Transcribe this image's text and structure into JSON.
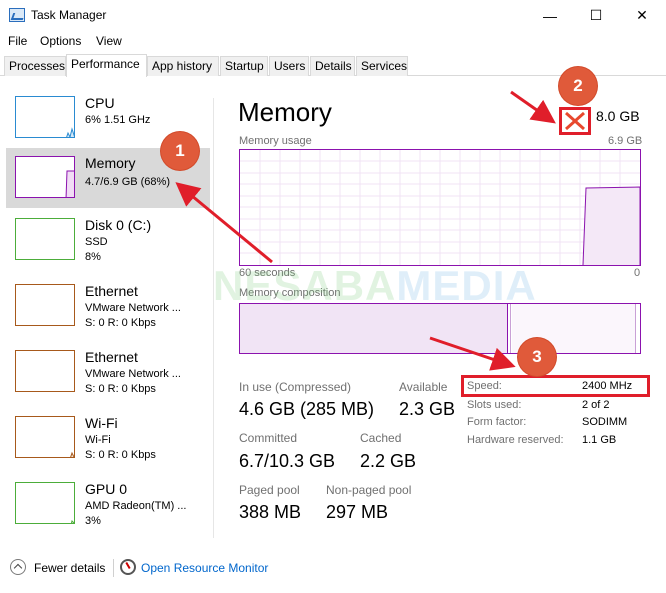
{
  "window": {
    "title": "Task Manager",
    "minimize_glyph": "—",
    "maximize_glyph": "☐",
    "close_glyph": "✕"
  },
  "menu": [
    "File",
    "Options",
    "View"
  ],
  "tabs": [
    "Processes",
    "Performance",
    "App history",
    "Startup",
    "Users",
    "Details",
    "Services"
  ],
  "active_tab": "Performance",
  "sidebar": [
    {
      "name": "CPU",
      "lines": [
        "6% 1.51 GHz"
      ],
      "color": "#2a8bd1",
      "icon": "cpu-graph"
    },
    {
      "name": "Memory",
      "lines": [
        "4.7/6.9 GB (68%)"
      ],
      "color": "#8b12ae",
      "icon": "memory-graph",
      "selected": true
    },
    {
      "name": "Disk 0 (C:)",
      "lines": [
        "SSD",
        "8%"
      ],
      "color": "#4cad3a",
      "icon": "disk-graph"
    },
    {
      "name": "Ethernet",
      "lines": [
        "VMware Network ...",
        "S: 0 R: 0 Kbps"
      ],
      "color": "#a7591b",
      "icon": "ethernet-graph"
    },
    {
      "name": "Ethernet",
      "lines": [
        "VMware Network ...",
        "S: 0 R: 0 Kbps"
      ],
      "color": "#a7591b",
      "icon": "ethernet-graph"
    },
    {
      "name": "Wi-Fi",
      "lines": [
        "Wi-Fi",
        "S: 0 R: 0 Kbps"
      ],
      "color": "#a7591b",
      "icon": "wifi-graph"
    },
    {
      "name": "GPU 0",
      "lines": [
        "AMD Radeon(TM) ...",
        "3%"
      ],
      "color": "#4cad3a",
      "icon": "gpu-graph"
    }
  ],
  "main": {
    "title": "Memory",
    "total": "8.0 GB",
    "usage_label": "Memory usage",
    "usage_max": "6.9 GB",
    "time_left": "60 seconds",
    "time_right": "0",
    "composition_label": "Memory composition",
    "accent": "#8b12ae",
    "stats": {
      "in_use_label": "In use (Compressed)",
      "in_use": "4.6 GB (285 MB)",
      "available_label": "Available",
      "available": "2.3 GB",
      "committed_label": "Committed",
      "committed": "6.7/10.3 GB",
      "cached_label": "Cached",
      "cached": "2.2 GB",
      "paged_label": "Paged pool",
      "paged": "388 MB",
      "nonpaged_label": "Non-paged pool",
      "nonpaged": "297 MB"
    },
    "details": [
      {
        "key": "Speed:",
        "value": "2400 MHz"
      },
      {
        "key": "Slots used:",
        "value": "2 of 2"
      },
      {
        "key": "Form factor:",
        "value": "SODIMM"
      },
      {
        "key": "Hardware reserved:",
        "value": "1.1 GB"
      }
    ]
  },
  "annotations": {
    "badge1": "1",
    "badge2": "2",
    "badge3": "3",
    "highlight_color": "#e01e2a"
  },
  "watermark": {
    "part1": "NESABA",
    "part2": "MEDIA"
  },
  "footer": {
    "fewer_details": "Fewer details",
    "resource_monitor": "Open Resource Monitor"
  }
}
